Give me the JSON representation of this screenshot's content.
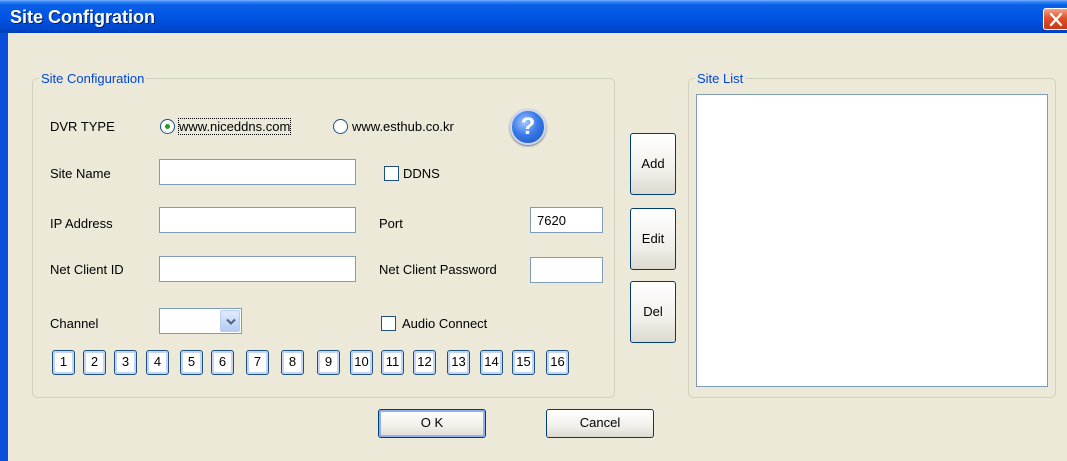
{
  "window": {
    "title": "Site Configration",
    "close_label": "X"
  },
  "site_config": {
    "legend": "Site Configuration",
    "dvr_type_label": "DVR TYPE",
    "dvr_options": [
      {
        "label": "www.niceddns.com",
        "selected": true
      },
      {
        "label": "www.esthub.co.kr",
        "selected": false
      }
    ],
    "help_icon_text": "?",
    "site_name": {
      "label": "Site Name",
      "value": ""
    },
    "ddns": {
      "label": "DDNS",
      "checked": false
    },
    "ip_address": {
      "label": "IP Address",
      "value": ""
    },
    "port": {
      "label": "Port",
      "value": "7620"
    },
    "net_client_id": {
      "label": "Net Client ID",
      "value": ""
    },
    "net_client_password": {
      "label": "Net Client Password",
      "value": ""
    },
    "channel": {
      "label": "Channel",
      "value": ""
    },
    "audio_connect": {
      "label": "Audio Connect",
      "checked": false
    },
    "channel_buttons": [
      "1",
      "2",
      "3",
      "4",
      "5",
      "6",
      "7",
      "8",
      "9",
      "10",
      "11",
      "12",
      "13",
      "14",
      "15",
      "16"
    ]
  },
  "actions": {
    "add": "Add",
    "edit": "Edit",
    "del": "Del",
    "ok": "O K",
    "cancel": "Cancel"
  },
  "site_list": {
    "legend": "Site List",
    "items": []
  },
  "colors": {
    "title_bar": "#0054e3",
    "legend_text": "#0046d5",
    "face": "#ece9d8"
  }
}
